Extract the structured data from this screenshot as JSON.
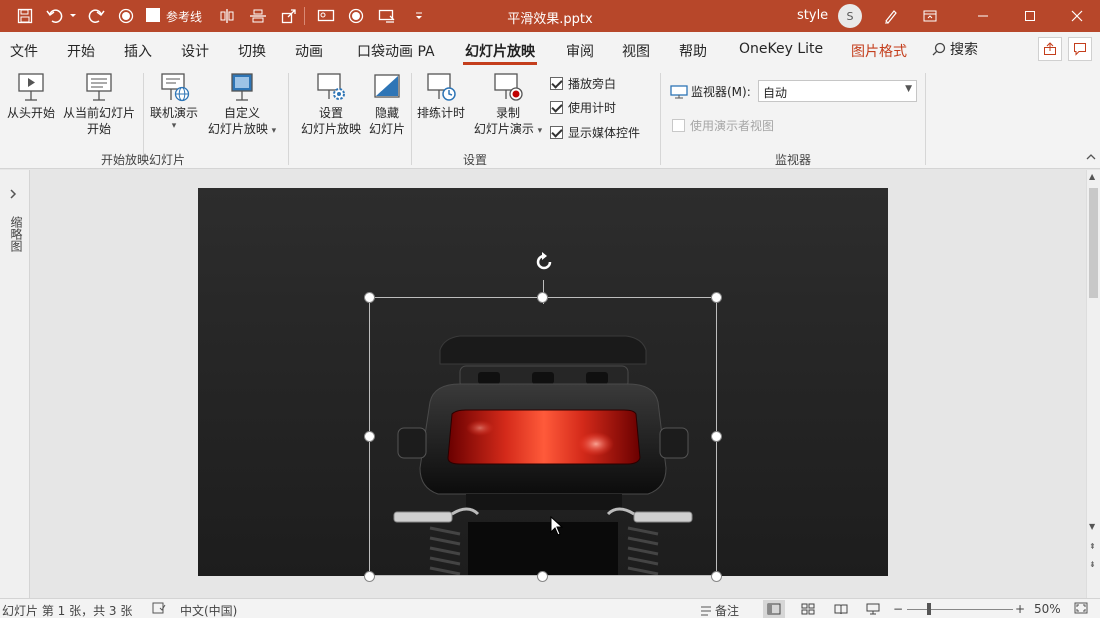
{
  "titlebar": {
    "quick_access": {
      "reference_line_label": "参考线"
    },
    "doc_title": "平滑效果.pptx",
    "user_name": "style",
    "avatar_initial": "S"
  },
  "tabs": [
    {
      "label": "文件"
    },
    {
      "label": "开始"
    },
    {
      "label": "插入"
    },
    {
      "label": "设计"
    },
    {
      "label": "切换"
    },
    {
      "label": "动画"
    },
    {
      "label": "口袋动画 PA"
    },
    {
      "label": "幻灯片放映"
    },
    {
      "label": "审阅"
    },
    {
      "label": "视图"
    },
    {
      "label": "帮助"
    },
    {
      "label": "OneKey Lite"
    },
    {
      "label": "图片格式"
    }
  ],
  "search_label": "搜索",
  "ribbon": {
    "start_group": {
      "from_beginning": "从头开始",
      "from_current_1": "从当前幻灯片",
      "from_current_2": "开始",
      "online_present": "联机演示",
      "custom_1": "自定义",
      "custom_2": "幻灯片放映",
      "label": "开始放映幻灯片"
    },
    "setup_group": {
      "setup_1": "设置",
      "setup_2": "幻灯片放映",
      "hide_1": "隐藏",
      "hide_2": "幻灯片",
      "rehearse": "排练计时",
      "record_1": "录制",
      "record_2": "幻灯片演示",
      "cb_narration": "播放旁白",
      "cb_timings": "使用计时",
      "cb_media": "显示媒体控件",
      "label": "设置"
    },
    "monitor_group": {
      "monitor_label": "监视器(M):",
      "monitor_value": "自动",
      "presenter_view": "使用演示者视图",
      "label": "监视器"
    }
  },
  "thumb_pane_label": "缩略图",
  "statusbar": {
    "slide_info": "幻灯片 第 1 张，共 3 张",
    "language": "中文(中国)",
    "notes": "备注",
    "zoom": "50%"
  }
}
